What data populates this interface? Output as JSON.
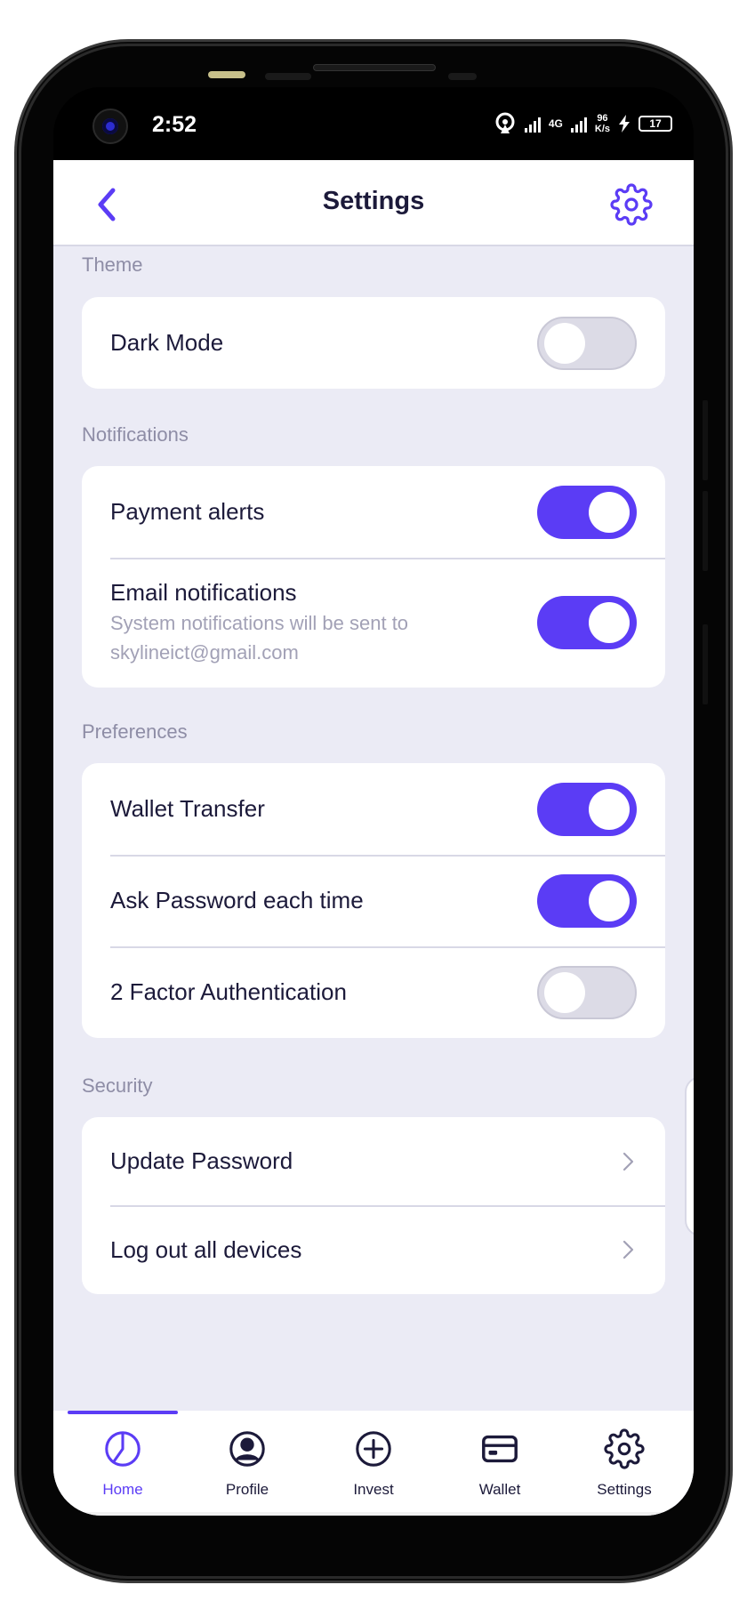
{
  "status_bar": {
    "time": "2:52",
    "network": "4G",
    "speed_value": "96",
    "speed_unit": "K/s",
    "battery": "17"
  },
  "header": {
    "title": "Settings",
    "back_icon": "chevron-left-icon",
    "action_icon": "gear-icon"
  },
  "sections": {
    "theme": {
      "title": "Theme",
      "items": [
        {
          "label": "Dark Mode",
          "enabled": false
        }
      ]
    },
    "notifications": {
      "title": "Notifications",
      "items": [
        {
          "label": "Payment alerts",
          "enabled": true
        },
        {
          "label": "Email notifications",
          "sub_line1": "System notifications will be sent to",
          "sub_line2": "skylineict@gmail.com",
          "enabled": true
        }
      ]
    },
    "preferences": {
      "title": "Preferences",
      "items": [
        {
          "label": "Wallet Transfer",
          "enabled": true
        },
        {
          "label": "Ask Password each time",
          "enabled": true
        },
        {
          "label": "2 Factor Authentication",
          "enabled": false
        }
      ]
    },
    "security": {
      "title": "Security",
      "items": [
        {
          "label": "Update Password"
        },
        {
          "label": "Log out all devices"
        }
      ]
    }
  },
  "tabbar": {
    "active": "Home",
    "tabs": [
      {
        "label": "Home",
        "icon": "pie-chart-icon"
      },
      {
        "label": "Profile",
        "icon": "user-circle-icon"
      },
      {
        "label": "Invest",
        "icon": "plus-circle-icon"
      },
      {
        "label": "Wallet",
        "icon": "card-icon"
      },
      {
        "label": "Settings",
        "icon": "gear-icon"
      }
    ]
  },
  "colors": {
    "accent": "#5b3cf5",
    "background": "#ebebf5",
    "text": "#1c1a3a",
    "muted": "#8e8da6"
  }
}
